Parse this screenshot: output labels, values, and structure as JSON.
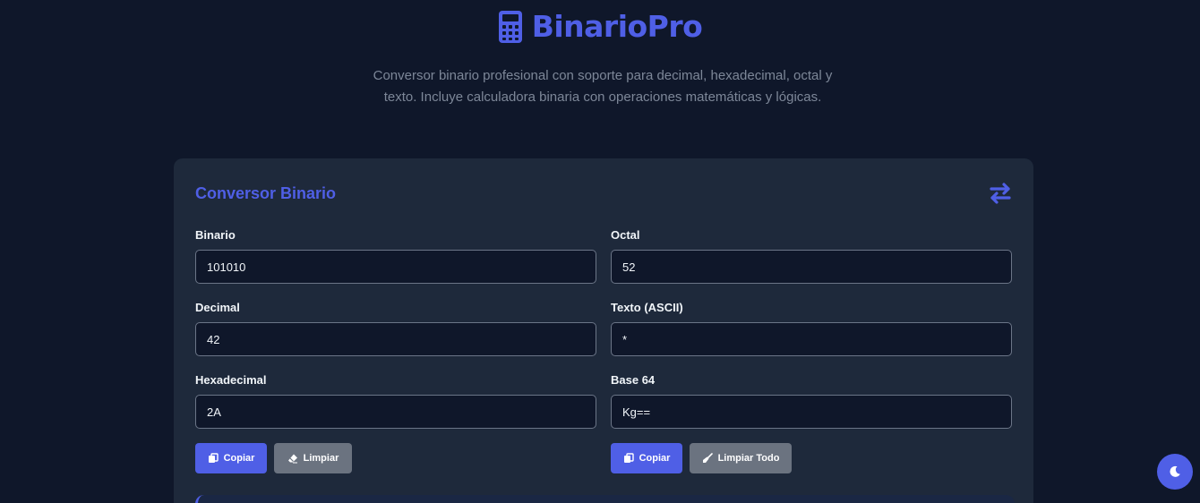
{
  "header": {
    "title": "BinarioPro",
    "logo_icon": "calculator-icon",
    "subtitle": "Conversor binario profesional con soporte para decimal, hexadecimal, octal y texto. Incluye calculadora binaria con operaciones matemáticas y lógicas."
  },
  "converter": {
    "title": "Conversor Binario",
    "swap_icon": "swap-arrows-icon",
    "fields": {
      "binary": {
        "label": "Binario",
        "value": "101010"
      },
      "decimal": {
        "label": "Decimal",
        "value": "42"
      },
      "hexadecimal": {
        "label": "Hexadecimal",
        "value": "2A"
      },
      "octal": {
        "label": "Octal",
        "value": "52"
      },
      "text": {
        "label": "Texto (ASCII)",
        "value": "*"
      },
      "base64": {
        "label": "Base 64",
        "value": "Kg=="
      }
    },
    "buttons": {
      "copy_left": "Copiar",
      "clear_left": "Limpiar",
      "copy_right": "Copiar",
      "clear_all": "Limpiar Todo"
    }
  },
  "theme_toggle": {
    "icon": "moon-icon"
  },
  "colors": {
    "background": "#0f172a",
    "card": "#1e293b",
    "accent": "#4f5fe6",
    "secondary_button": "#6b7380"
  }
}
